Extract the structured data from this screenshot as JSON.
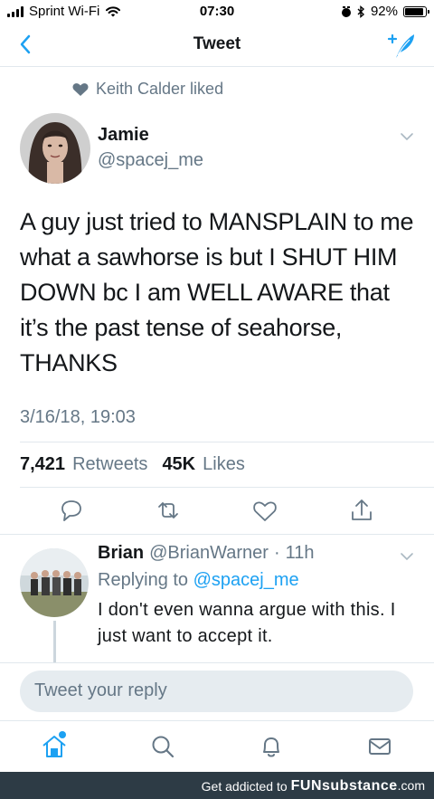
{
  "status_bar": {
    "carrier": "Sprint Wi-Fi",
    "time": "07:30",
    "battery_percent": "92%",
    "battery_level": 0.92
  },
  "nav": {
    "title": "Tweet",
    "back_icon": "chevron-left-icon",
    "compose_icon": "compose-tweet-icon"
  },
  "social_context": {
    "text": "Keith Calder liked",
    "icon": "heart-icon"
  },
  "tweet": {
    "author_name": "Jamie",
    "author_handle": "@spacej_me",
    "text": "A guy just tried to MANSPLAIN to me what a sawhorse is but I SHUT HIM DOWN bc I am WELL AWARE that it’s the past tense of seahorse, THANKS",
    "timestamp": "3/16/18, 19:03",
    "retweets_count": "7,421",
    "retweets_label": "Retweets",
    "likes_count": "45K",
    "likes_label": "Likes"
  },
  "actions": [
    "reply-icon",
    "retweet-icon",
    "like-icon",
    "share-icon"
  ],
  "reply": {
    "name": "Brian",
    "handle": "@BrianWarner",
    "separator": "·",
    "time": "11h",
    "replying_prefix": "Replying to",
    "replying_to": "@spacej_me",
    "text": "I don't even wanna argue with this. I just want to accept it."
  },
  "composer": {
    "placeholder": "Tweet your reply"
  },
  "tab_bar": [
    "home-icon",
    "search-icon",
    "notifications-icon",
    "messages-icon"
  ],
  "footer": {
    "prefix": "Get addicted to",
    "brand": "FUNsubstance",
    "domain": ".com"
  },
  "colors": {
    "accent": "#1da1f2",
    "secondary_text": "#657786",
    "primary_text": "#14171a",
    "divider": "#e1e8ed",
    "footer_bg": "#2d3b45"
  }
}
